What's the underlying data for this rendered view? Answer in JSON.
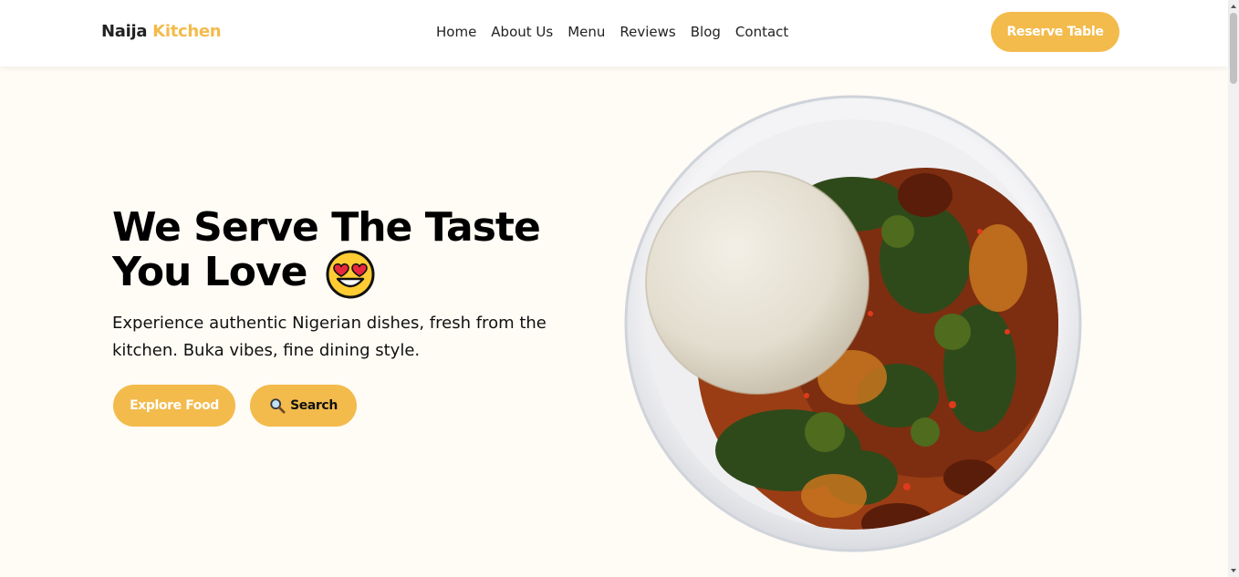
{
  "brand": {
    "name_part1": "Naija",
    "name_part2": "Kitchen",
    "accent_color": "#f3bb4c"
  },
  "nav": {
    "items": [
      {
        "label": "Home"
      },
      {
        "label": "About Us"
      },
      {
        "label": "Menu"
      },
      {
        "label": "Reviews"
      },
      {
        "label": "Blog"
      },
      {
        "label": "Contact"
      }
    ],
    "reserve_label": "Reserve Table"
  },
  "hero": {
    "title_line1": "We Serve The Taste",
    "title_line2": "You Love",
    "emoji_icon": "heart-eyes-emoji-icon",
    "subtitle": "Experience authentic Nigerian dishes, fresh from the kitchen. Buka vibes, fine dining style.",
    "explore_label": "Explore Food",
    "search_label": "Search",
    "search_icon": "magnifier-icon",
    "image_subject": "pounded yam with vegetable soup bowl"
  },
  "colors": {
    "background": "#fffbf5",
    "button": "#f3bb4c"
  }
}
